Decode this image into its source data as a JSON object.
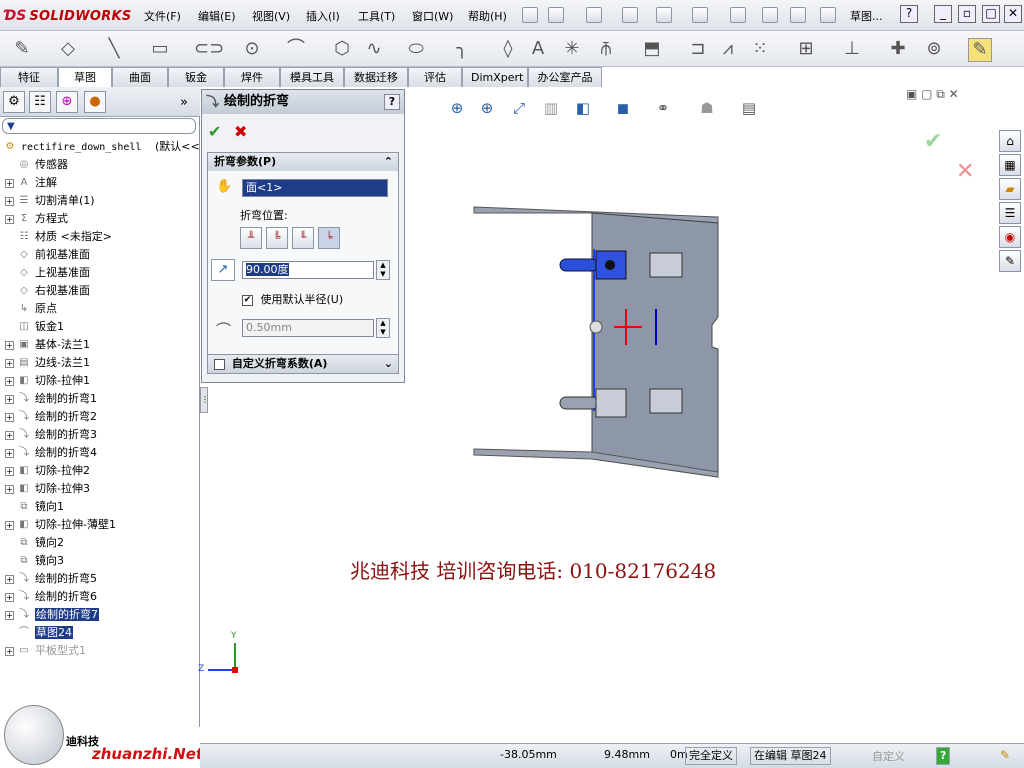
{
  "app": {
    "brand": "SOLIDWORKS",
    "doc_title": "草图..."
  },
  "menu": [
    "文件(F)",
    "编辑(E)",
    "视图(V)",
    "插入(I)",
    "工具(T)",
    "窗口(W)",
    "帮助(H)"
  ],
  "tabs": [
    "特征",
    "草图",
    "曲面",
    "钣金",
    "焊件",
    "模具工具",
    "数据迁移",
    "评估",
    "DimXpert",
    "办公室产品"
  ],
  "active_tab": "草图",
  "tree": {
    "root": "rectifire_down_shell",
    "root_config": "(默认<<",
    "items": [
      {
        "label": "传感器",
        "expandable": false
      },
      {
        "label": "注解",
        "expandable": true
      },
      {
        "label": "切割清单(1)",
        "expandable": true
      },
      {
        "label": "方程式",
        "expandable": true
      },
      {
        "label": "材质 <未指定>",
        "expandable": false
      },
      {
        "label": "前视基准面",
        "expandable": false
      },
      {
        "label": "上视基准面",
        "expandable": false
      },
      {
        "label": "右视基准面",
        "expandable": false
      },
      {
        "label": "原点",
        "expandable": false
      },
      {
        "label": "钣金1",
        "expandable": false
      },
      {
        "label": "基体-法兰1",
        "expandable": true
      },
      {
        "label": "边线-法兰1",
        "expandable": true
      },
      {
        "label": "切除-拉伸1",
        "expandable": true
      },
      {
        "label": "绘制的折弯1",
        "expandable": true
      },
      {
        "label": "绘制的折弯2",
        "expandable": true
      },
      {
        "label": "绘制的折弯3",
        "expandable": true
      },
      {
        "label": "绘制的折弯4",
        "expandable": true
      },
      {
        "label": "切除-拉伸2",
        "expandable": true
      },
      {
        "label": "切除-拉伸3",
        "expandable": true
      },
      {
        "label": "镜向1",
        "expandable": false
      },
      {
        "label": "切除-拉伸-薄壁1",
        "expandable": true
      },
      {
        "label": "镜向2",
        "expandable": false
      },
      {
        "label": "镜向3",
        "expandable": false
      },
      {
        "label": "绘制的折弯5",
        "expandable": true
      },
      {
        "label": "绘制的折弯6",
        "expandable": true
      },
      {
        "label": "绘制的折弯7",
        "expandable": true,
        "selected": true
      },
      {
        "label": "草图24",
        "expandable": false,
        "selected": true
      },
      {
        "label": "平板型式1",
        "expandable": true,
        "grey": true
      }
    ]
  },
  "property_manager": {
    "title": "绘制的折弯",
    "help": "?",
    "group_params": "折弯参数(P)",
    "face_value": "面<1>",
    "bend_position_label": "折弯位置:",
    "angle_value": "90.00度",
    "use_default_radius": "使用默认半径(U)",
    "radius_value": "0.50mm",
    "custom_bend_label": "自定义折弯系数(A)"
  },
  "watermark_text": "兆迪科技    培训咨询电话: 010-82176248",
  "status": {
    "x": "-38.05mm",
    "y": "9.48mm",
    "z": "0m",
    "state": "完全定义",
    "editing": "在编辑 草图24",
    "custom": "自定义"
  },
  "corner_logo_text": "迪科技",
  "corner_site": "zhuanzhi.Net",
  "axes": {
    "y": "Y",
    "z": "Z"
  },
  "colors": {
    "accent": "#1f3c88",
    "brand_red": "#c8102e",
    "watermark": "#8b1010",
    "part": "#8e97a8"
  }
}
